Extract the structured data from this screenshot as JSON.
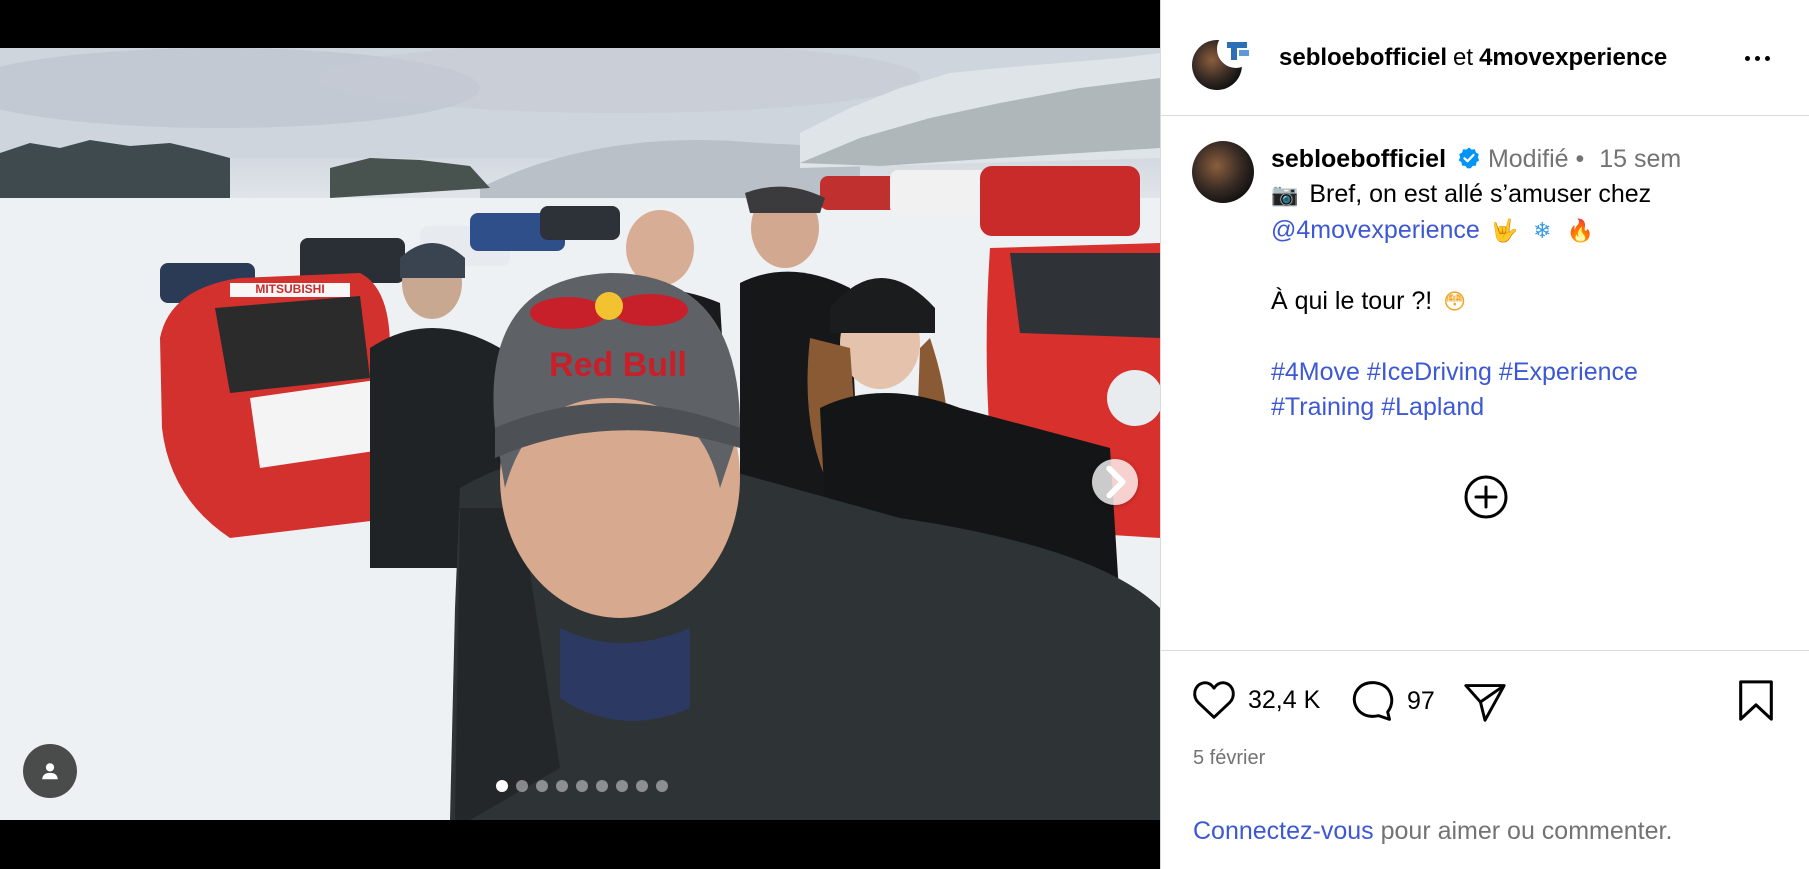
{
  "post": {
    "header": {
      "user1": "sebloebofficiel",
      "connector": "et",
      "user2": "4movexperience"
    },
    "caption": {
      "username": "sebloebofficiel",
      "edited": "Modifié",
      "bullet": "•",
      "age": "15 sem",
      "line1_emoji": "📷",
      "line1_text": "Bref, on est allé s’amuser chez",
      "mention": "@4movexperience",
      "line2_emojis": [
        "🤟",
        "❄",
        "🔥"
      ],
      "line3_text": "À qui le tour ?!",
      "line3_emoji": "😳",
      "hashtags_row1": [
        "#4Move",
        "#IceDriving",
        "#Experience"
      ],
      "hashtags_row2": [
        "#Training",
        "#Lapland"
      ]
    },
    "stats": {
      "likes": "32,4 K",
      "comments": "97"
    },
    "date": "5 février",
    "login_prompt": {
      "link": "Connectez-vous",
      "rest": "pour aimer ou commenter."
    }
  },
  "carousel": {
    "total_slides": 9,
    "active_index": 0
  },
  "photo": {
    "beanie_text": "Red Bull",
    "car_text": "MITSUBISHI"
  },
  "colors": {
    "link": "#3d58d3",
    "verified": "#0095f6",
    "muted": "#737373",
    "border": "#dbdbdb"
  },
  "icons": {
    "more": "more-icon",
    "like": "heart-icon",
    "comment": "comment-icon",
    "share": "share-icon",
    "save": "bookmark-icon",
    "next": "chevron-right-icon",
    "tag": "user-tag-icon",
    "expand": "plus-circle-icon"
  }
}
